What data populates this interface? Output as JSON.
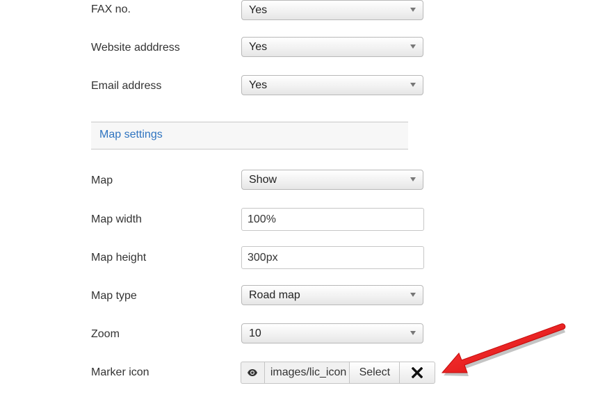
{
  "fields_top": [
    {
      "label": "FAX no.",
      "value": "Yes"
    },
    {
      "label": "Website adddress",
      "value": "Yes"
    },
    {
      "label": "Email address",
      "value": "Yes"
    }
  ],
  "section": {
    "title": "Map settings"
  },
  "map": {
    "map_label": "Map",
    "map_value": "Show",
    "width_label": "Map width",
    "width_value": "100%",
    "height_label": "Map height",
    "height_value": "300px",
    "type_label": "Map type",
    "type_value": "Road map",
    "zoom_label": "Zoom",
    "zoom_value": "10",
    "marker_label": "Marker icon",
    "marker_path": "images/lic_icon",
    "select_label": "Select"
  },
  "icons": {
    "preview": "eye-icon",
    "clear": "close-icon"
  },
  "colors": {
    "link": "#2f74c0",
    "arrow": "#e01515"
  }
}
